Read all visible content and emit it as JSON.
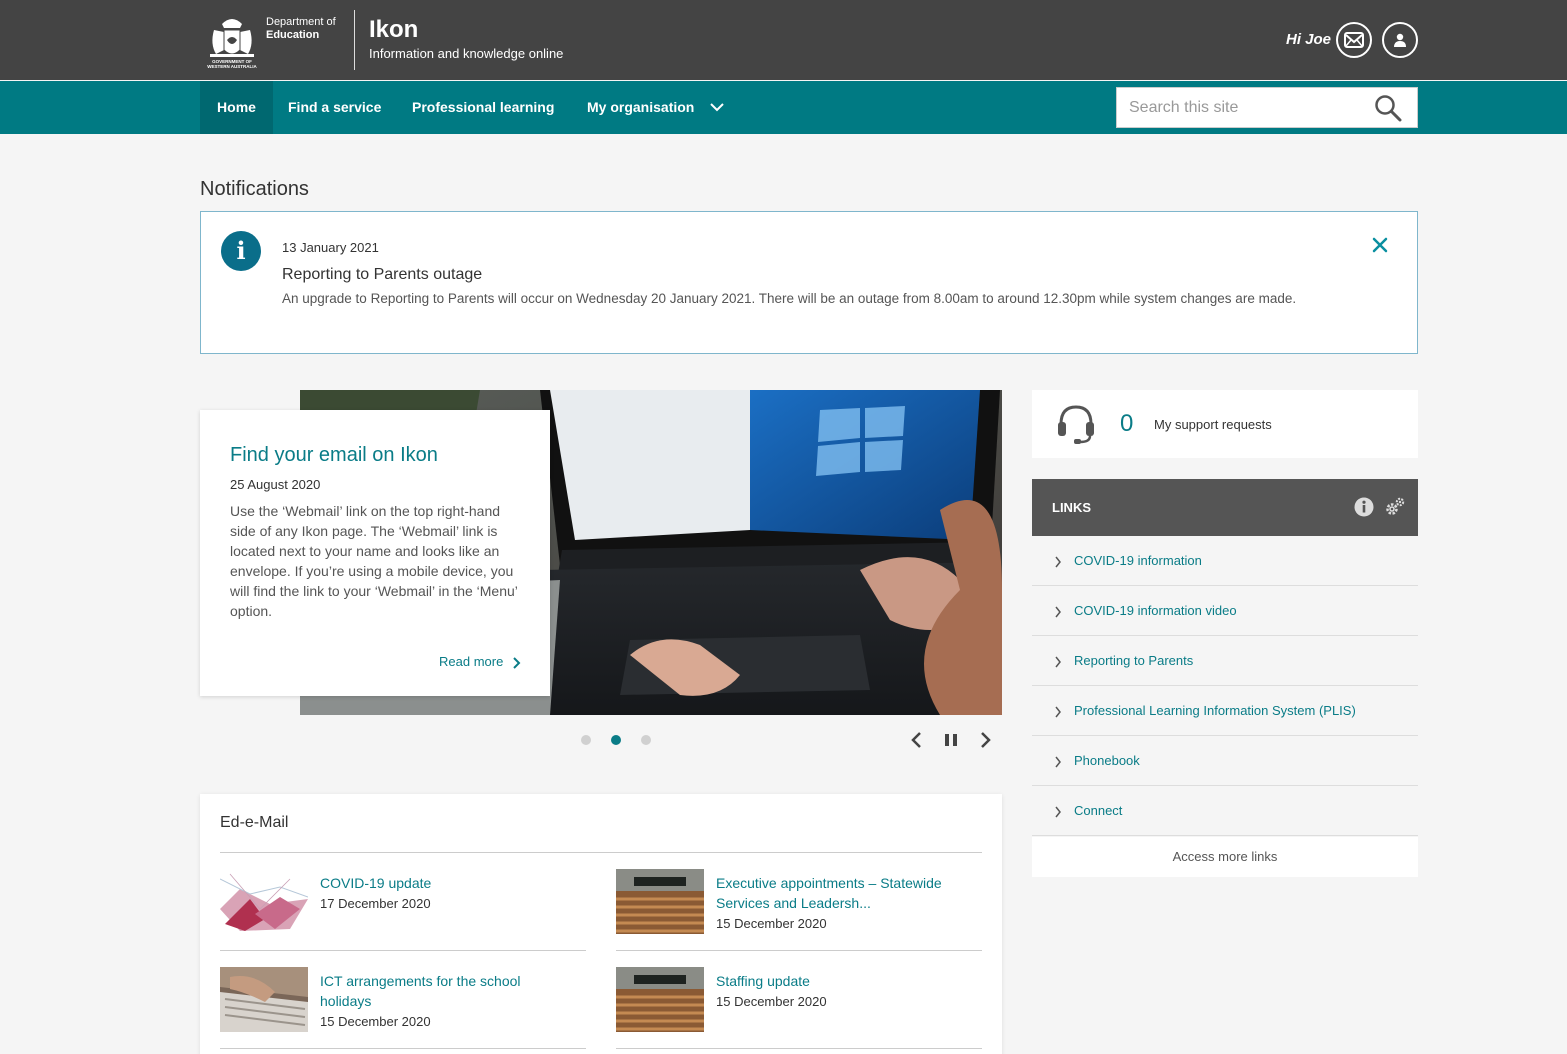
{
  "header": {
    "dept_line1": "Department of",
    "dept_line2": "Education",
    "crest_line1": "GOVERNMENT OF",
    "crest_line2": "WESTERN AUSTRALIA",
    "app_title": "Ikon",
    "app_subtitle": "Information and knowledge online",
    "greeting": "Hi Joe"
  },
  "nav": {
    "items": [
      {
        "label": "Home"
      },
      {
        "label": "Find a service"
      },
      {
        "label": "Professional learning"
      },
      {
        "label": "My organisation"
      }
    ],
    "search_placeholder": "Search this site"
  },
  "notifications": {
    "heading": "Notifications",
    "items": [
      {
        "date": "13 January 2021",
        "title": "Reporting to Parents outage",
        "body": "An upgrade to Reporting to Parents will occur on Wednesday 20 January 2021. There will be an outage from 8.00am to around 12.30pm while system changes are made."
      }
    ]
  },
  "carousel": {
    "title": "Find your email on Ikon",
    "date": "25 August 2020",
    "body": "Use the ‘Webmail’ link on the top right-hand side of any Ikon page. The ‘Webmail’ link is located next to your name and looks like an envelope. If you’re using a mobile device, you will find the link to your ‘Webmail’ in the ‘Menu’ option.",
    "read_more": "Read more",
    "active_slide": 2,
    "slide_count": 3
  },
  "support": {
    "count": "0",
    "label": "My support requests"
  },
  "links": {
    "title": "LINKS",
    "items": [
      {
        "label": "COVID-19 information"
      },
      {
        "label": "COVID-19 information video"
      },
      {
        "label": "Reporting to Parents"
      },
      {
        "label": "Professional Learning Information System (PLIS)"
      },
      {
        "label": "Phonebook"
      },
      {
        "label": "Connect"
      }
    ],
    "more": "Access more links"
  },
  "email": {
    "heading": "Ed-e-Mail",
    "items": [
      {
        "title": "COVID-19 update",
        "date": "17 December 2020"
      },
      {
        "title": "Executive appointments – Statewide Services and Leadersh...",
        "date": "15 December 2020"
      },
      {
        "title": "ICT arrangements for the school holidays",
        "date": "15 December 2020"
      },
      {
        "title": "Staffing update",
        "date": "15 December 2020"
      }
    ]
  },
  "colors": {
    "header_bg": "#444444",
    "nav_bg": "#007a83",
    "accent": "#0a7c87",
    "info_icon": "#0a6e8a"
  }
}
